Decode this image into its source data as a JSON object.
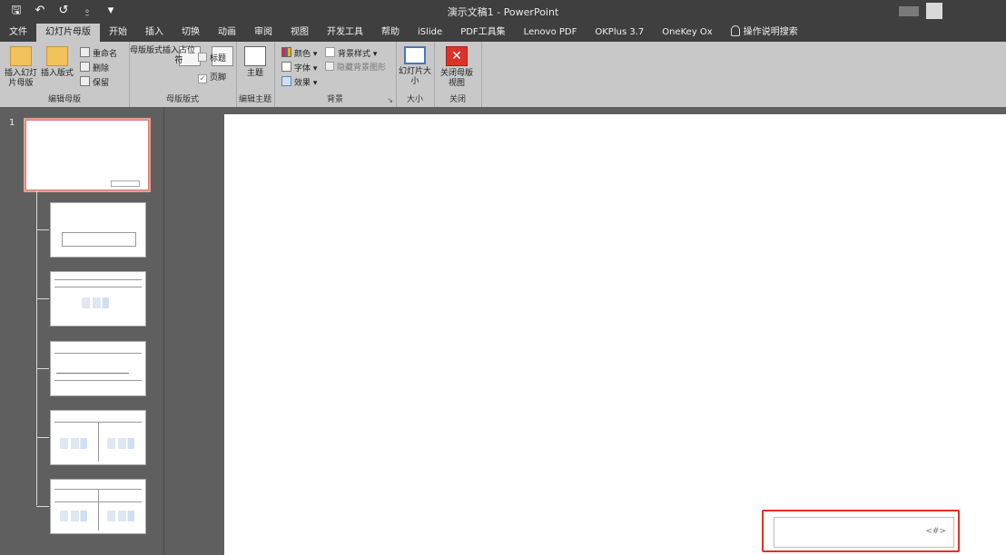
{
  "window": {
    "title": "演示文稿1 - PowerPoint"
  },
  "quick_access": {
    "save": "🖫",
    "undo": "↶",
    "redo": "↺",
    "touch": "⍛",
    "more": "▾"
  },
  "tabs": [
    {
      "label": "文件",
      "active": false
    },
    {
      "label": "幻灯片母版",
      "active": true
    },
    {
      "label": "开始",
      "active": false
    },
    {
      "label": "插入",
      "active": false
    },
    {
      "label": "切换",
      "active": false
    },
    {
      "label": "动画",
      "active": false
    },
    {
      "label": "审阅",
      "active": false
    },
    {
      "label": "视图",
      "active": false
    },
    {
      "label": "开发工具",
      "active": false
    },
    {
      "label": "帮助",
      "active": false
    },
    {
      "label": "iSlide",
      "active": false
    },
    {
      "label": "PDF工具集",
      "active": false
    },
    {
      "label": "Lenovo PDF",
      "active": false
    },
    {
      "label": "OKPlus 3.7",
      "active": false
    },
    {
      "label": "OneKey Ox",
      "active": false
    },
    {
      "label": "操作说明搜索",
      "active": false
    }
  ],
  "ribbon": {
    "edit_master": {
      "label": "编辑母版",
      "insert_master": "插入幻灯片母版",
      "insert_layout": "插入版式",
      "rename": "重命名",
      "delete": "删除",
      "preserve": "保留"
    },
    "master_layout": {
      "label": "母版版式",
      "master_layout_btn": "母版版式",
      "insert_placeholder": "插入占位符",
      "title_chk": "标题",
      "footer_chk": "页脚"
    },
    "edit_theme": {
      "label": "编辑主题",
      "themes_btn": "主题"
    },
    "background": {
      "label": "背景",
      "colors": "颜色",
      "fonts": "字体",
      "effects": "效果",
      "bg_styles": "背景样式",
      "hide_bg": "隐藏背景图形"
    },
    "size": {
      "label": "大小",
      "slide_size": "幻灯片大小"
    },
    "close": {
      "label": "关闭",
      "close_master": "关闭母版视图"
    }
  },
  "thumbnails": {
    "slide_number": "1"
  },
  "slide": {
    "footer_text": "<#>"
  }
}
